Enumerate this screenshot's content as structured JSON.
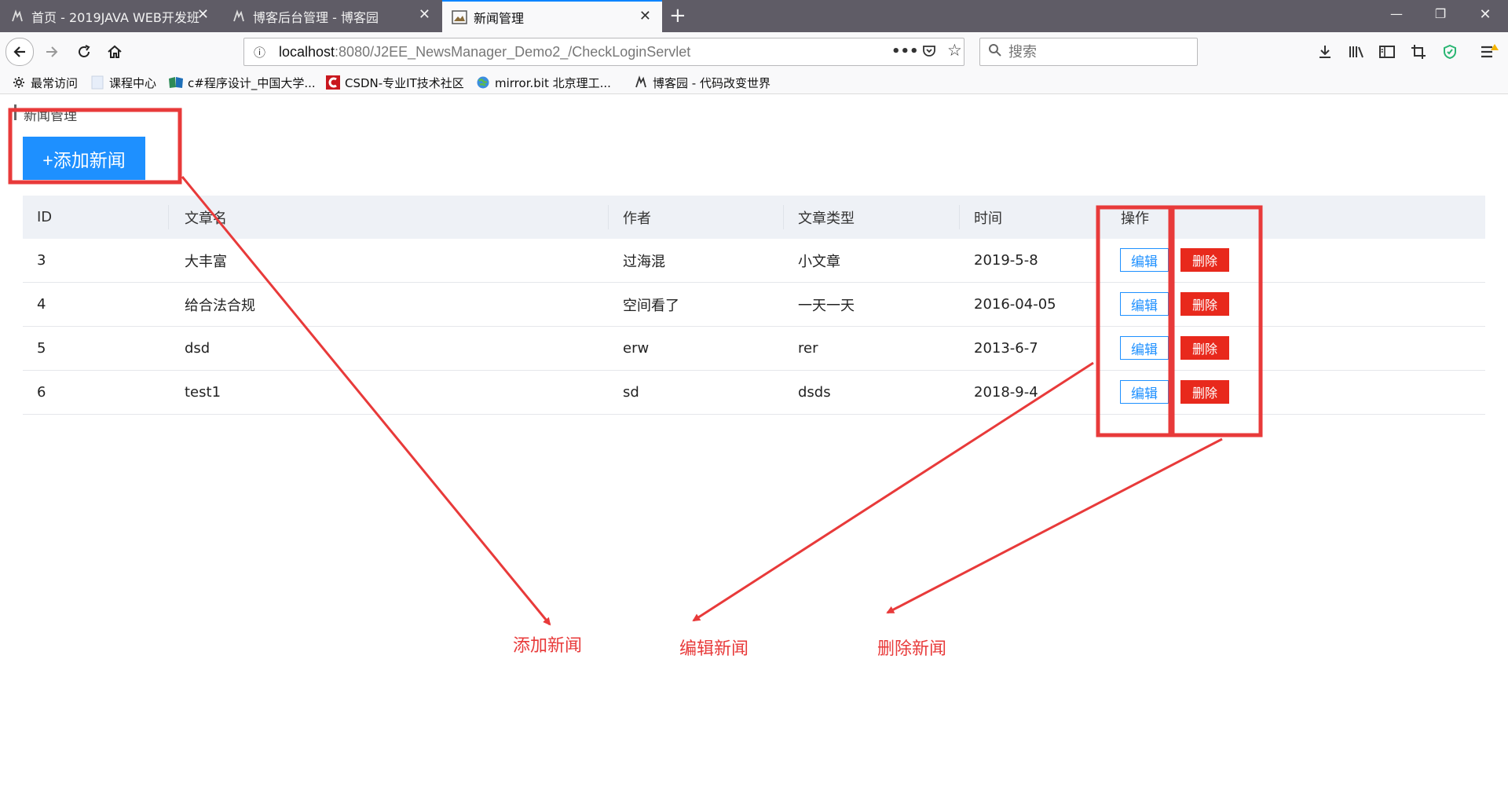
{
  "browser": {
    "tabs": [
      {
        "title": "首页 - 2019JAVA WEB开发班",
        "active": false
      },
      {
        "title": "博客后台管理 - 博客园",
        "active": false
      },
      {
        "title": "新闻管理",
        "active": true
      }
    ],
    "url_host": "localhost",
    "url_path": ":8080/J2EE_NewsManager_Demo2_/CheckLoginServlet",
    "search_placeholder": "搜索",
    "bookmarks": [
      {
        "label": "最常访问",
        "icon": "gear-icon"
      },
      {
        "label": "课程中心",
        "icon": "page-icon"
      },
      {
        "label": "c#程序设计_中国大学...",
        "icon": "book-icon"
      },
      {
        "label": "CSDN-专业IT技术社区",
        "icon": "csdn-logo-icon"
      },
      {
        "label": "mirror.bit 北京理工...",
        "icon": "globe-icon"
      },
      {
        "label": "博客园 - 代码改变世界",
        "icon": "cnblogs-icon"
      }
    ]
  },
  "page": {
    "title": "新闻管理",
    "add_button": "+添加新闻",
    "table": {
      "headers": [
        "ID",
        "文章名",
        "作者",
        "文章类型",
        "时间",
        "操作"
      ],
      "rows": [
        {
          "id": "3",
          "name": "大丰富",
          "author": "过海混",
          "type": "小文章",
          "time": "2019-5-8"
        },
        {
          "id": "4",
          "name": "给合法合规",
          "author": "空间看了",
          "type": "一天一天",
          "time": "2016-04-05"
        },
        {
          "id": "5",
          "name": "dsd",
          "author": "erw",
          "type": "rer",
          "time": "2013-6-7"
        },
        {
          "id": "6",
          "name": "test1",
          "author": "sd",
          "type": "dsds",
          "time": "2018-9-4"
        }
      ],
      "edit_label": "编辑",
      "delete_label": "删除"
    }
  },
  "annotations": {
    "add": "添加新闻",
    "edit": "编辑新闻",
    "delete": "删除新闻",
    "color": "#e83a3a"
  },
  "colors": {
    "primary": "#1e90ff",
    "danger": "#e8291c",
    "tabbar": "#5f5c66"
  }
}
